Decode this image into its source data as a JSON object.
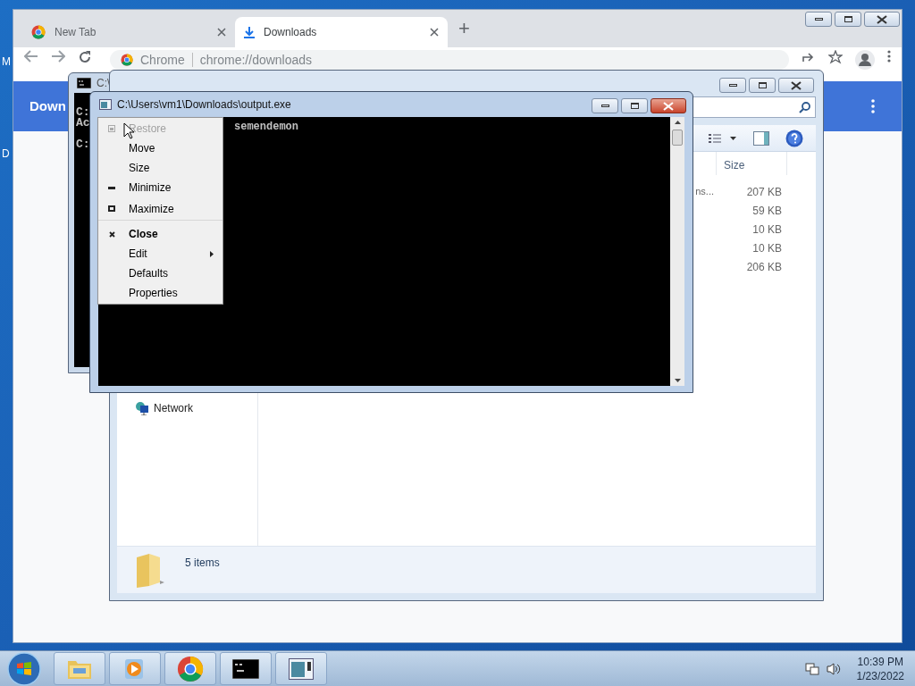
{
  "desktop": {
    "icon_labels": [
      "M",
      "D"
    ]
  },
  "browser": {
    "tabs": [
      {
        "title": "New Tab",
        "selected": false,
        "kind": "chrome"
      },
      {
        "title": "Downloads",
        "selected": true,
        "kind": "download"
      }
    ],
    "new_tab": "+",
    "omnibox": {
      "site": "Chrome",
      "url": "chrome://downloads"
    },
    "header": {
      "title": "Down"
    }
  },
  "back_console": {
    "title": "C:\\",
    "blocks": [
      [
        "C:",
        "Ac"
      ],
      [
        "C:"
      ]
    ]
  },
  "explorer": {
    "columns": [
      "Size"
    ],
    "rows": [
      {
        "name": "ns...",
        "size": "207 KB"
      },
      {
        "size": "59 KB"
      },
      {
        "size": "10 KB"
      },
      {
        "size": "10 KB"
      },
      {
        "size": "206 KB"
      }
    ],
    "nav": [
      {
        "label": "Network"
      }
    ],
    "status": "5 items"
  },
  "console": {
    "title": "C:\\Users\\vm1\\Downloads\\output.exe",
    "lines": [
      "semendemon"
    ]
  },
  "system_menu": {
    "items": [
      {
        "label": "Restore",
        "kind": "restore",
        "disabled": true,
        "default": false,
        "submenu": false,
        "separator_after": false
      },
      {
        "label": "Move",
        "kind": "plain",
        "disabled": false,
        "default": false,
        "submenu": false,
        "separator_after": false
      },
      {
        "label": "Size",
        "kind": "plain",
        "disabled": false,
        "default": false,
        "submenu": false,
        "separator_after": false
      },
      {
        "label": "Minimize",
        "kind": "minimize",
        "disabled": false,
        "default": false,
        "submenu": false,
        "separator_after": false
      },
      {
        "label": "Maximize",
        "kind": "maximize",
        "disabled": false,
        "default": false,
        "submenu": false,
        "separator_after": true
      },
      {
        "label": "Close",
        "kind": "close",
        "disabled": false,
        "default": true,
        "submenu": false,
        "separator_after": false
      },
      {
        "label": "Edit",
        "kind": "plain",
        "disabled": false,
        "default": false,
        "submenu": true,
        "separator_after": false
      },
      {
        "label": "Defaults",
        "kind": "plain",
        "disabled": false,
        "default": false,
        "submenu": false,
        "separator_after": false
      },
      {
        "label": "Properties",
        "kind": "plain",
        "disabled": false,
        "default": false,
        "submenu": false,
        "separator_after": false
      }
    ]
  },
  "taskbar": {
    "buttons": [
      {
        "kind": "folder"
      },
      {
        "kind": "media"
      },
      {
        "kind": "chrome"
      },
      {
        "kind": "console"
      },
      {
        "kind": "window"
      }
    ],
    "clock": {
      "time": "10:39 PM",
      "date": "1/23/2022"
    }
  }
}
